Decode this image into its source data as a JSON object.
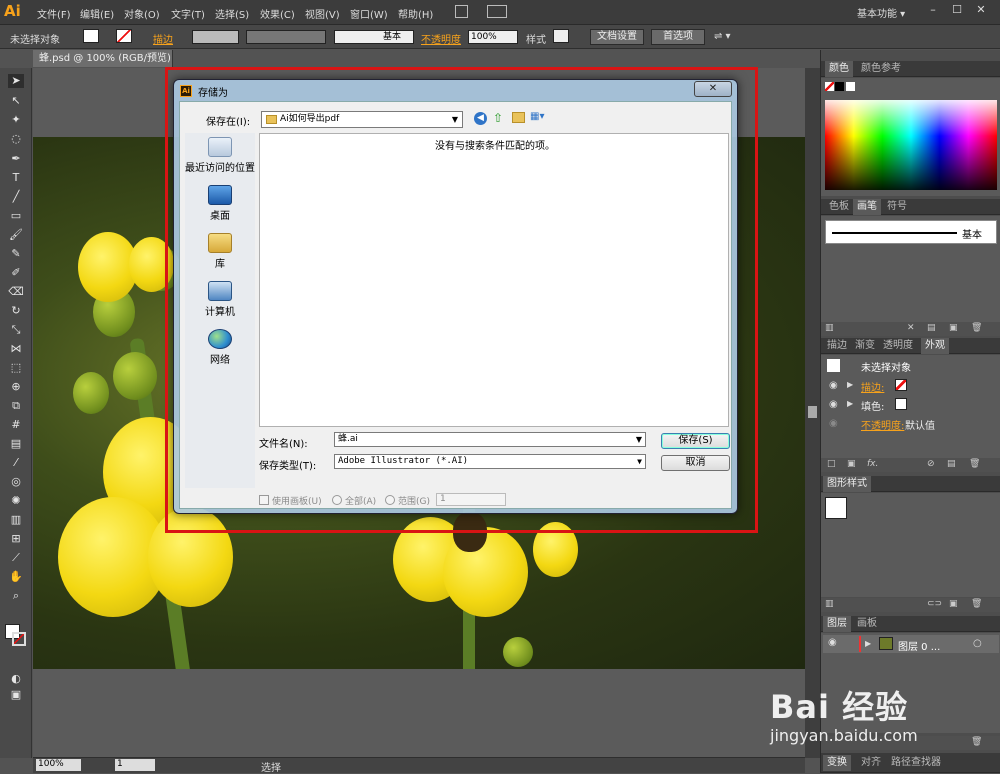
{
  "app": {
    "logo": "Ai",
    "workspace": "基本功能 ▾"
  },
  "menu": [
    "文件(F)",
    "编辑(E)",
    "对象(O)",
    "文字(T)",
    "选择(S)",
    "效果(C)",
    "视图(V)",
    "窗口(W)",
    "帮助(H)"
  ],
  "control": {
    "selection": "未选择对象",
    "stroke_label": "描边",
    "brush": "基本",
    "opacity_label": "不透明度",
    "opacity_value": "100%",
    "style_label": "样式",
    "doc_setup": "文档设置",
    "prefs": "首选项"
  },
  "document": {
    "tab": "蜂.psd @ 100% (RGB/预览)"
  },
  "status": {
    "zoom": "100%",
    "page": "1",
    "mode": "选择"
  },
  "panels": {
    "color_tabs": [
      "颜色",
      "颜色参考"
    ],
    "stroke_tabs": [
      "色板",
      "画笔",
      "符号"
    ],
    "brush_name": "基本",
    "appearance_tabs": [
      "描边",
      "渐变",
      "透明度",
      "外观"
    ],
    "appearance_title": "未选择对象",
    "appearance_rows": [
      {
        "label": "描边:",
        "type": "stroke"
      },
      {
        "label": "填色:",
        "type": "fill"
      },
      {
        "label": "不透明度:",
        "value": "默认值"
      }
    ],
    "graphic_styles_tab": "图形样式",
    "layers_tabs": [
      "图层",
      "画板"
    ],
    "layer_name": "图层 0 ...",
    "bottom_tabs": [
      "变换",
      "对齐",
      "路径查找器"
    ]
  },
  "dialog": {
    "title": "存储为",
    "close": "✕",
    "lookin_label": "保存在(I):",
    "lookin_value": "Ai如何导出pdf",
    "places": [
      "最近访问的位置",
      "桌面",
      "库",
      "计算机",
      "网络"
    ],
    "empty_message": "没有与搜索条件匹配的项。",
    "filename_label": "文件名(N):",
    "filename_value": "蜂.ai",
    "filetype_label": "保存类型(T):",
    "filetype_value": "Adobe Illustrator (*.AI)",
    "save_button": "保存(S)",
    "cancel_button": "取消",
    "use_artboards": "使用画板(U)",
    "all_option": "全部(A)",
    "range_option": "范围(G)",
    "range_value": "1"
  },
  "watermark": {
    "brand": "Bai 经验",
    "url": "jingyan.baidu.com"
  },
  "colors": {
    "accent": "#f7a21b",
    "highlight": "#d91414",
    "panel": "#4d4d4d"
  }
}
